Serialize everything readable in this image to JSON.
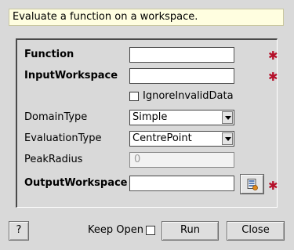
{
  "description": "Evaluate a function on a workspace.",
  "properties": {
    "function": {
      "label": "Function",
      "value": ""
    },
    "input_workspace": {
      "label": "InputWorkspace",
      "value": ""
    },
    "ignore_invalid": {
      "label": "IgnoreInvalidData",
      "checked": false
    },
    "domain_type": {
      "label": "DomainType",
      "selected": "Simple"
    },
    "evaluation_type": {
      "label": "EvaluationType",
      "selected": "CentrePoint"
    },
    "peak_radius": {
      "label": "PeakRadius",
      "value": "0"
    },
    "output_workspace": {
      "label": "OutputWorkspace",
      "value": ""
    }
  },
  "required_marker": "✱",
  "footer": {
    "help_label": "?",
    "keep_open_label": "Keep Open",
    "keep_open_checked": false,
    "run_label": "Run",
    "close_label": "Close"
  },
  "colors": {
    "required": "#b5102a",
    "description_bg": "#fffee0"
  }
}
